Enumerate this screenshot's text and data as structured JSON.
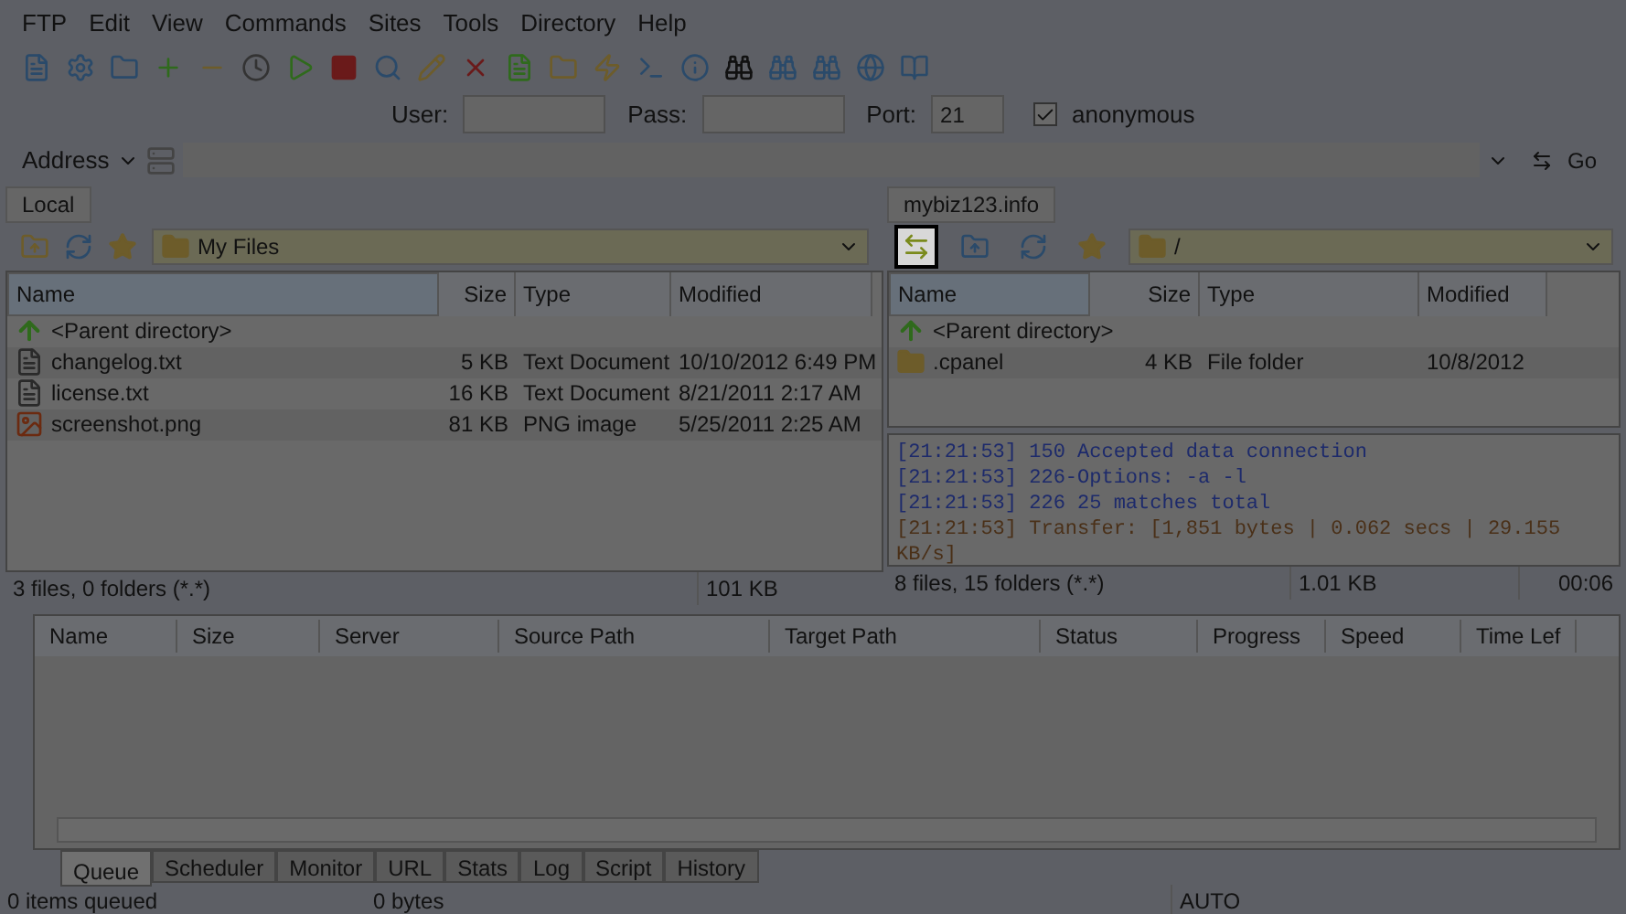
{
  "menu": [
    "FTP",
    "Edit",
    "View",
    "Commands",
    "Sites",
    "Tools",
    "Directory",
    "Help"
  ],
  "login": {
    "fields": [
      {
        "label": "User:"
      },
      {
        "label": "Pass:"
      },
      {
        "label": "Port:",
        "value": "21"
      }
    ],
    "anonymous": {
      "label": "anonymous",
      "checked": true
    }
  },
  "address": {
    "label": "Address",
    "go": "Go"
  },
  "local": {
    "tab": "Local",
    "path": "My Files",
    "columns": [
      "Name",
      "Size",
      "Type",
      "Modified"
    ],
    "rows": [
      {
        "kind": "parent",
        "name": "<Parent directory>"
      },
      {
        "kind": "text",
        "name": "changelog.txt",
        "size": "5 KB",
        "type": "Text Document",
        "modified": "10/10/2012 6:49 PM"
      },
      {
        "kind": "text",
        "name": "license.txt",
        "size": "16 KB",
        "type": "Text Document",
        "modified": "8/21/2011 2:17 AM"
      },
      {
        "kind": "image",
        "name": "screenshot.png",
        "size": "81 KB",
        "type": "PNG image",
        "modified": "5/25/2011 2:25 AM"
      }
    ],
    "status": [
      "3 files, 0 folders (*.*)",
      "101 KB"
    ]
  },
  "remote": {
    "tab": "mybiz123.info",
    "path": "/",
    "toolbar": [
      {
        "kind": "sync",
        "highlighted": true
      },
      {
        "kind": "up",
        "highlighted": false
      },
      {
        "kind": "refresh",
        "highlighted": false
      },
      {
        "kind": "star",
        "highlighted": false
      }
    ],
    "columns": [
      "Name",
      "Size",
      "Type",
      "Modified"
    ],
    "rows": [
      {
        "kind": "parent",
        "name": "<Parent directory>"
      },
      {
        "kind": "folder",
        "name": ".cpanel",
        "size": "4 KB",
        "type": "File folder",
        "modified": "10/8/2012"
      }
    ],
    "log": [
      "[21:21:53] 150 Accepted data connection",
      "[21:21:53] 226-Options: -a -l",
      "[21:21:53] 226 25 matches total",
      "[21:21:53] Transfer: [1,851 bytes | 0.062 secs | 29.155 KB/s]"
    ],
    "status": [
      "8 files, 15 folders (*.*)",
      "1.01 KB",
      "00:06"
    ]
  },
  "queue": {
    "columns": [
      "Name",
      "Size",
      "Server",
      "Source Path",
      "Target Path",
      "Status",
      "Progress",
      "Speed",
      "Time Lef"
    ],
    "tabs": [
      {
        "label": "Queue",
        "selected": true
      },
      {
        "label": "Scheduler",
        "selected": false
      },
      {
        "label": "Monitor",
        "selected": false
      },
      {
        "label": "URL",
        "selected": false
      },
      {
        "label": "Stats",
        "selected": false
      },
      {
        "label": "Log",
        "selected": false
      },
      {
        "label": "Script",
        "selected": false
      },
      {
        "label": "History",
        "selected": false
      }
    ]
  },
  "status_bar": [
    "0 items queued",
    "0 bytes",
    "AUTO"
  ]
}
